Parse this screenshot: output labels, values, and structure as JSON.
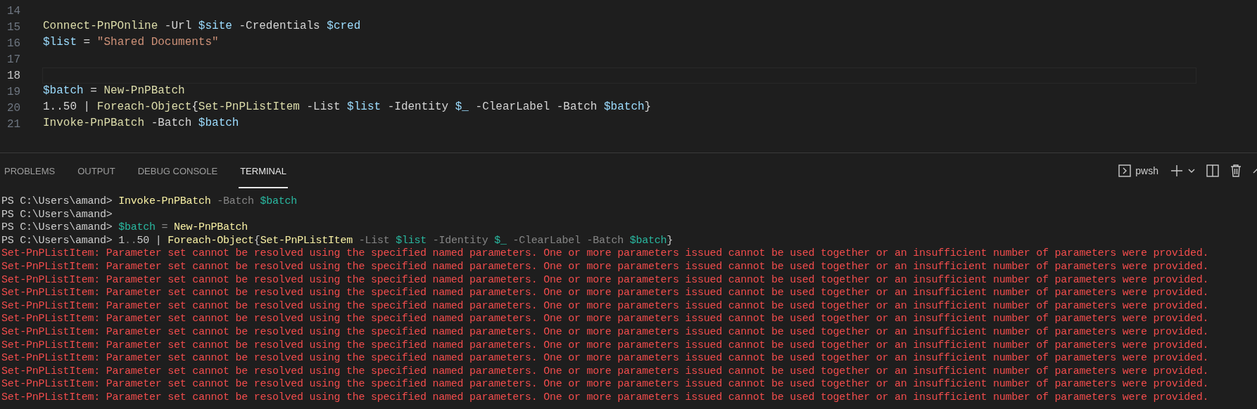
{
  "editor": {
    "lines": [
      {
        "number": "14",
        "current": false
      },
      {
        "number": "15",
        "current": false,
        "tokens": [
          {
            "kind": "command",
            "text": "Connect-PnPOnline"
          },
          {
            "kind": "param",
            "text": " -Url "
          },
          {
            "kind": "variable",
            "text": "$site"
          },
          {
            "kind": "param",
            "text": " -Credentials "
          },
          {
            "kind": "variable",
            "text": "$cred"
          }
        ]
      },
      {
        "number": "16",
        "current": false,
        "tokens": [
          {
            "kind": "variable",
            "text": "$list"
          },
          {
            "kind": "param",
            "text": " = "
          },
          {
            "kind": "string",
            "text": "\"Shared Documents\""
          }
        ]
      },
      {
        "number": "17",
        "current": false
      },
      {
        "number": "18",
        "current": true
      },
      {
        "number": "19",
        "current": false,
        "tokens": [
          {
            "kind": "variable",
            "text": "$batch"
          },
          {
            "kind": "param",
            "text": " = "
          },
          {
            "kind": "command",
            "text": "New-PnPBatch"
          }
        ]
      },
      {
        "number": "20",
        "current": false,
        "tokens": [
          {
            "kind": "param",
            "text": "1..50 | "
          },
          {
            "kind": "command",
            "text": "Foreach-Object"
          },
          {
            "kind": "param",
            "text": "{"
          },
          {
            "kind": "command",
            "text": "Set-PnPListItem"
          },
          {
            "kind": "param",
            "text": " -List "
          },
          {
            "kind": "variable",
            "text": "$list"
          },
          {
            "kind": "param",
            "text": " -Identity "
          },
          {
            "kind": "variable",
            "text": "$_"
          },
          {
            "kind": "param",
            "text": " -ClearLabel -Batch "
          },
          {
            "kind": "variable",
            "text": "$batch"
          },
          {
            "kind": "param",
            "text": "}"
          }
        ]
      },
      {
        "number": "21",
        "current": false,
        "tokens": [
          {
            "kind": "command",
            "text": "Invoke-PnPBatch"
          },
          {
            "kind": "param",
            "text": " -Batch "
          },
          {
            "kind": "variable",
            "text": "$batch"
          }
        ]
      }
    ]
  },
  "panel": {
    "tabs": [
      {
        "label": "PROBLEMS",
        "selected": false
      },
      {
        "label": "OUTPUT",
        "selected": false
      },
      {
        "label": "DEBUG CONSOLE",
        "selected": false
      },
      {
        "label": "TERMINAL",
        "selected": true
      }
    ],
    "shell": "pwsh"
  },
  "terminal": {
    "lines": [
      {
        "tokens": [
          {
            "kind": "prompt",
            "text": "PS C:\\Users\\amand> "
          },
          {
            "kind": "command",
            "text": "Invoke-PnPBatch"
          },
          {
            "kind": "param",
            "text": " -Batch "
          },
          {
            "kind": "variable",
            "text": "$batch"
          }
        ]
      },
      {
        "tokens": [
          {
            "kind": "prompt",
            "text": "PS C:\\Users\\amand>"
          }
        ]
      },
      {
        "tokens": [
          {
            "kind": "prompt",
            "text": "PS C:\\Users\\amand> "
          },
          {
            "kind": "variable",
            "text": "$batch"
          },
          {
            "kind": "param",
            "text": " = "
          },
          {
            "kind": "command",
            "text": "New-PnPBatch"
          }
        ]
      },
      {
        "tokens": [
          {
            "kind": "prompt",
            "text": "PS C:\\Users\\amand> "
          },
          {
            "kind": "plain",
            "text": "1"
          },
          {
            "kind": "param",
            "text": ".."
          },
          {
            "kind": "plain",
            "text": "50 | "
          },
          {
            "kind": "command",
            "text": "Foreach-Object"
          },
          {
            "kind": "plain",
            "text": "{"
          },
          {
            "kind": "command",
            "text": "Set-PnPListItem"
          },
          {
            "kind": "param",
            "text": " -List "
          },
          {
            "kind": "variable",
            "text": "$list"
          },
          {
            "kind": "param",
            "text": " -Identity "
          },
          {
            "kind": "variable",
            "text": "$_"
          },
          {
            "kind": "param",
            "text": " -ClearLabel -Batch "
          },
          {
            "kind": "variable",
            "text": "$batch"
          },
          {
            "kind": "plain",
            "text": "}"
          }
        ]
      },
      {
        "tokens": [
          {
            "kind": "error",
            "text": "Set-PnPListItem: Parameter set cannot be resolved using the specified named parameters. One or more parameters issued cannot be used together or an insufficient number of parameters were provided."
          }
        ]
      },
      {
        "tokens": [
          {
            "kind": "error",
            "text": "Set-PnPListItem: Parameter set cannot be resolved using the specified named parameters. One or more parameters issued cannot be used together or an insufficient number of parameters were provided."
          }
        ]
      },
      {
        "tokens": [
          {
            "kind": "error",
            "text": "Set-PnPListItem: Parameter set cannot be resolved using the specified named parameters. One or more parameters issued cannot be used together or an insufficient number of parameters were provided."
          }
        ]
      },
      {
        "tokens": [
          {
            "kind": "error",
            "text": "Set-PnPListItem: Parameter set cannot be resolved using the specified named parameters. One or more parameters issued cannot be used together or an insufficient number of parameters were provided."
          }
        ]
      },
      {
        "tokens": [
          {
            "kind": "error",
            "text": "Set-PnPListItem: Parameter set cannot be resolved using the specified named parameters. One or more parameters issued cannot be used together or an insufficient number of parameters were provided."
          }
        ]
      },
      {
        "tokens": [
          {
            "kind": "error",
            "text": "Set-PnPListItem: Parameter set cannot be resolved using the specified named parameters. One or more parameters issued cannot be used together or an insufficient number of parameters were provided."
          }
        ]
      },
      {
        "tokens": [
          {
            "kind": "error",
            "text": "Set-PnPListItem: Parameter set cannot be resolved using the specified named parameters. One or more parameters issued cannot be used together or an insufficient number of parameters were provided."
          }
        ]
      },
      {
        "tokens": [
          {
            "kind": "error",
            "text": "Set-PnPListItem: Parameter set cannot be resolved using the specified named parameters. One or more parameters issued cannot be used together or an insufficient number of parameters were provided."
          }
        ]
      },
      {
        "tokens": [
          {
            "kind": "error",
            "text": "Set-PnPListItem: Parameter set cannot be resolved using the specified named parameters. One or more parameters issued cannot be used together or an insufficient number of parameters were provided."
          }
        ]
      },
      {
        "tokens": [
          {
            "kind": "error",
            "text": "Set-PnPListItem: Parameter set cannot be resolved using the specified named parameters. One or more parameters issued cannot be used together or an insufficient number of parameters were provided."
          }
        ]
      },
      {
        "tokens": [
          {
            "kind": "error",
            "text": "Set-PnPListItem: Parameter set cannot be resolved using the specified named parameters. One or more parameters issued cannot be used together or an insufficient number of parameters were provided."
          }
        ]
      },
      {
        "tokens": [
          {
            "kind": "error",
            "text": "Set-PnPListItem: Parameter set cannot be resolved using the specified named parameters. One or more parameters issued cannot be used together or an insufficient number of parameters were provided."
          }
        ]
      }
    ]
  }
}
